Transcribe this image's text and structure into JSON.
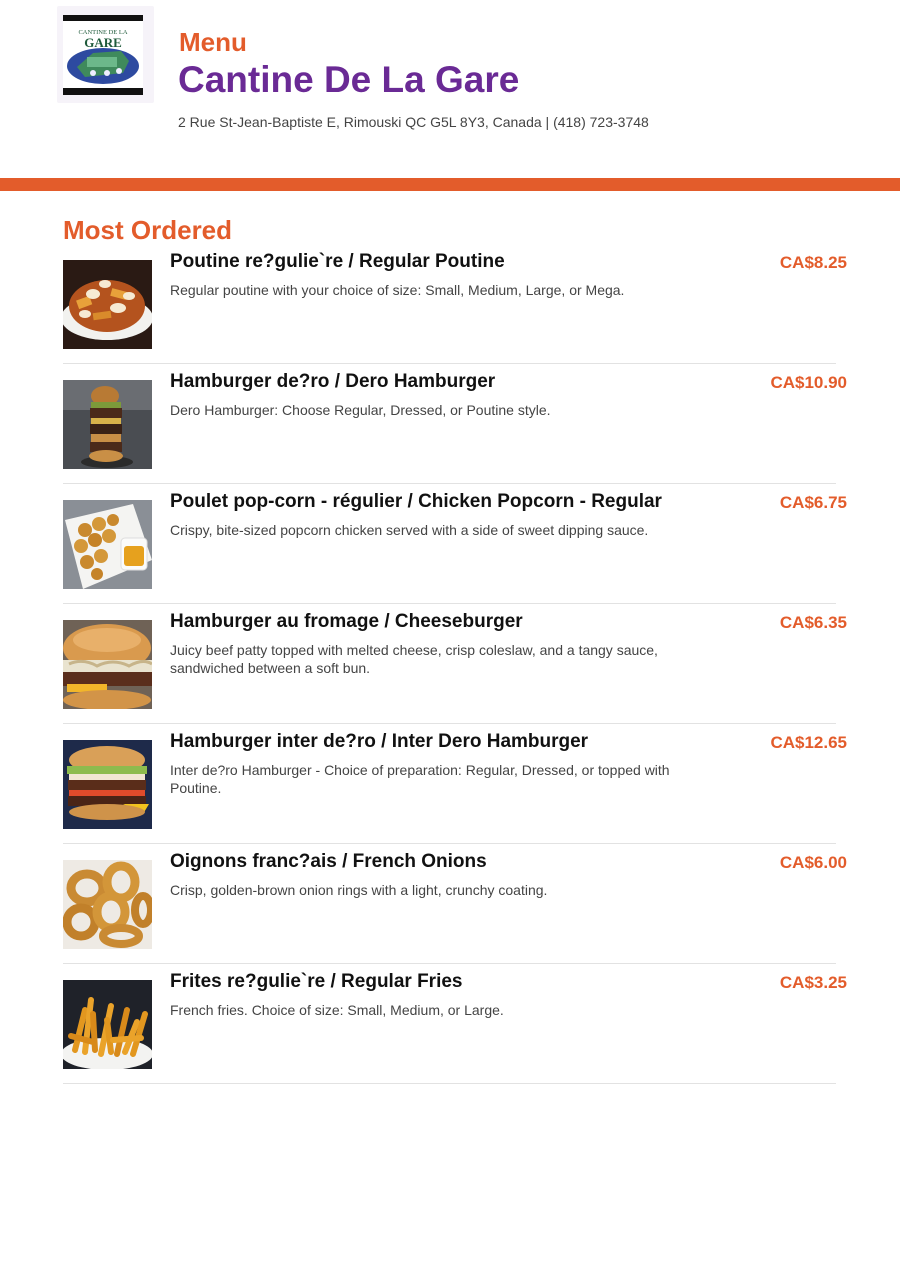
{
  "header": {
    "eyebrow": "Menu",
    "restaurant_name": "Cantine De La Gare",
    "address_line": "2 Rue St-Jean-Baptiste E, Rimouski QC G5L 8Y3, Canada | (418) 723-3748",
    "logo": {
      "top_text": "CANTINE DE LA",
      "main_text": "GARE"
    }
  },
  "colors": {
    "accent": "#e35c2b",
    "title": "#6a2a95"
  },
  "section": {
    "title": "Most Ordered"
  },
  "items": [
    {
      "name": "Poutine re?gulie`re / Regular Poutine",
      "description": "Regular poutine with your choice of size: Small, Medium, Large, or Mega.",
      "price": "CA$8.25",
      "image_icon": "poutine-photo"
    },
    {
      "name": "Hamburger de?ro / Dero Hamburger",
      "description": "Dero Hamburger: Choose Regular, Dressed, or Poutine style.",
      "price": "CA$10.90",
      "image_icon": "hamburger-photo"
    },
    {
      "name": "Poulet pop-corn - régulier / Chicken Popcorn - Regular",
      "description": "Crispy, bite-sized popcorn chicken served with a side of sweet dipping sauce.",
      "price": "CA$6.75",
      "image_icon": "popcorn-chicken-photo"
    },
    {
      "name": "Hamburger au fromage / Cheeseburger",
      "description": "Juicy beef patty topped with melted cheese, crisp coleslaw, and a tangy sauce, sandwiched between a soft bun.",
      "price": "CA$6.35",
      "image_icon": "cheeseburger-photo"
    },
    {
      "name": "Hamburger inter de?ro / Inter Dero Hamburger",
      "description": "Inter de?ro Hamburger - Choice of preparation: Regular, Dressed, or topped with Poutine.",
      "price": "CA$12.65",
      "image_icon": "inter-hamburger-photo"
    },
    {
      "name": "Oignons franc?ais / French Onions",
      "description": "Crisp, golden-brown onion rings with a light, crunchy coating.",
      "price": "CA$6.00",
      "image_icon": "onion-rings-photo"
    },
    {
      "name": "Frites re?gulie`re / Regular Fries",
      "description": "French fries. Choice of size: Small, Medium, or Large.",
      "price": "CA$3.25",
      "image_icon": "fries-photo"
    }
  ]
}
